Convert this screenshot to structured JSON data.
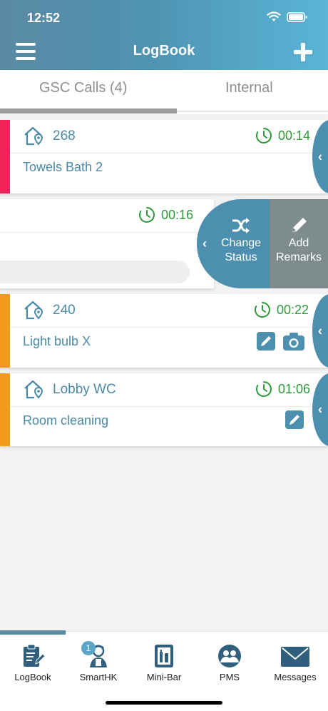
{
  "status_bar": {
    "time": "12:52"
  },
  "header": {
    "title": "LogBook"
  },
  "tabs": [
    {
      "label": "GSC Calls (4)"
    },
    {
      "label": "Internal"
    }
  ],
  "calls": [
    {
      "room": "268",
      "elapsed": "00:14",
      "description": "Towels Bath 2",
      "priority_color": "#f0255a"
    },
    {
      "elapsed": "00:16",
      "actions": [
        {
          "label": "Change Status"
        },
        {
          "label": "Add Remarks"
        }
      ]
    },
    {
      "room": "240",
      "elapsed": "00:22",
      "description": "Light bulb X",
      "priority_color": "#f29a1b"
    },
    {
      "room": "Lobby WC",
      "elapsed": "01:06",
      "description": "Room cleaning",
      "priority_color": "#f29a1b"
    }
  ],
  "bottom_nav": [
    {
      "label": "LogBook",
      "icon": "clipboard-pen-icon"
    },
    {
      "label": "SmartHK",
      "icon": "housekeeper-icon",
      "badge": "1"
    },
    {
      "label": "Mini-Bar",
      "icon": "minibar-icon"
    },
    {
      "label": "PMS",
      "icon": "users-group-icon"
    },
    {
      "label": "Messages",
      "icon": "envelope-icon"
    }
  ],
  "colors": {
    "accent": "#4d8fae",
    "elapsed_green": "#2e9a3a",
    "text_blue": "#4a8aa8"
  }
}
